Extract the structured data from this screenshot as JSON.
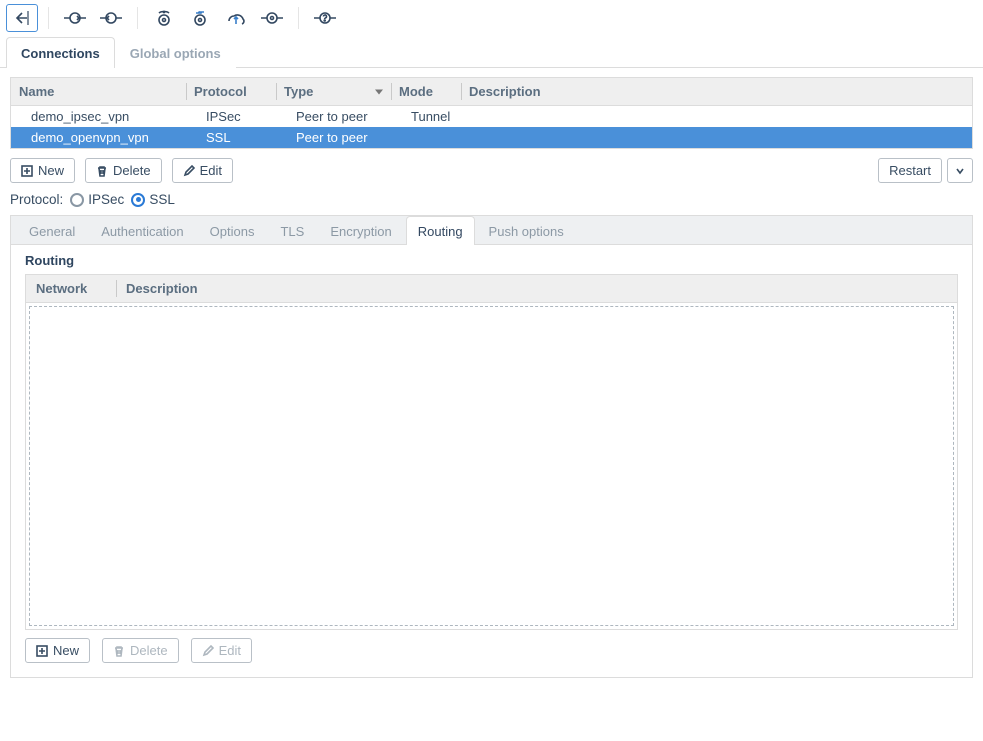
{
  "mainTabs": {
    "connections": "Connections",
    "global": "Global options"
  },
  "table": {
    "headers": {
      "name": "Name",
      "protocol": "Protocol",
      "type": "Type",
      "mode": "Mode",
      "desc": "Description"
    },
    "rows": [
      {
        "name": "demo_ipsec_vpn",
        "protocol": "IPSec",
        "type": "Peer to peer",
        "mode": "Tunnel",
        "desc": ""
      },
      {
        "name": "demo_openvpn_vpn",
        "protocol": "SSL",
        "type": "Peer to peer",
        "mode": "",
        "desc": ""
      }
    ]
  },
  "buttons": {
    "new": "New",
    "delete": "Delete",
    "edit": "Edit",
    "restart": "Restart"
  },
  "protoRow": {
    "label": "Protocol:",
    "ipsec": "IPSec",
    "ssl": "SSL"
  },
  "subTabs": {
    "general": "General",
    "auth": "Authentication",
    "options": "Options",
    "tls": "TLS",
    "enc": "Encryption",
    "routing": "Routing",
    "push": "Push options"
  },
  "panel": {
    "title": "Routing",
    "headers": {
      "network": "Network",
      "desc": "Description"
    }
  }
}
